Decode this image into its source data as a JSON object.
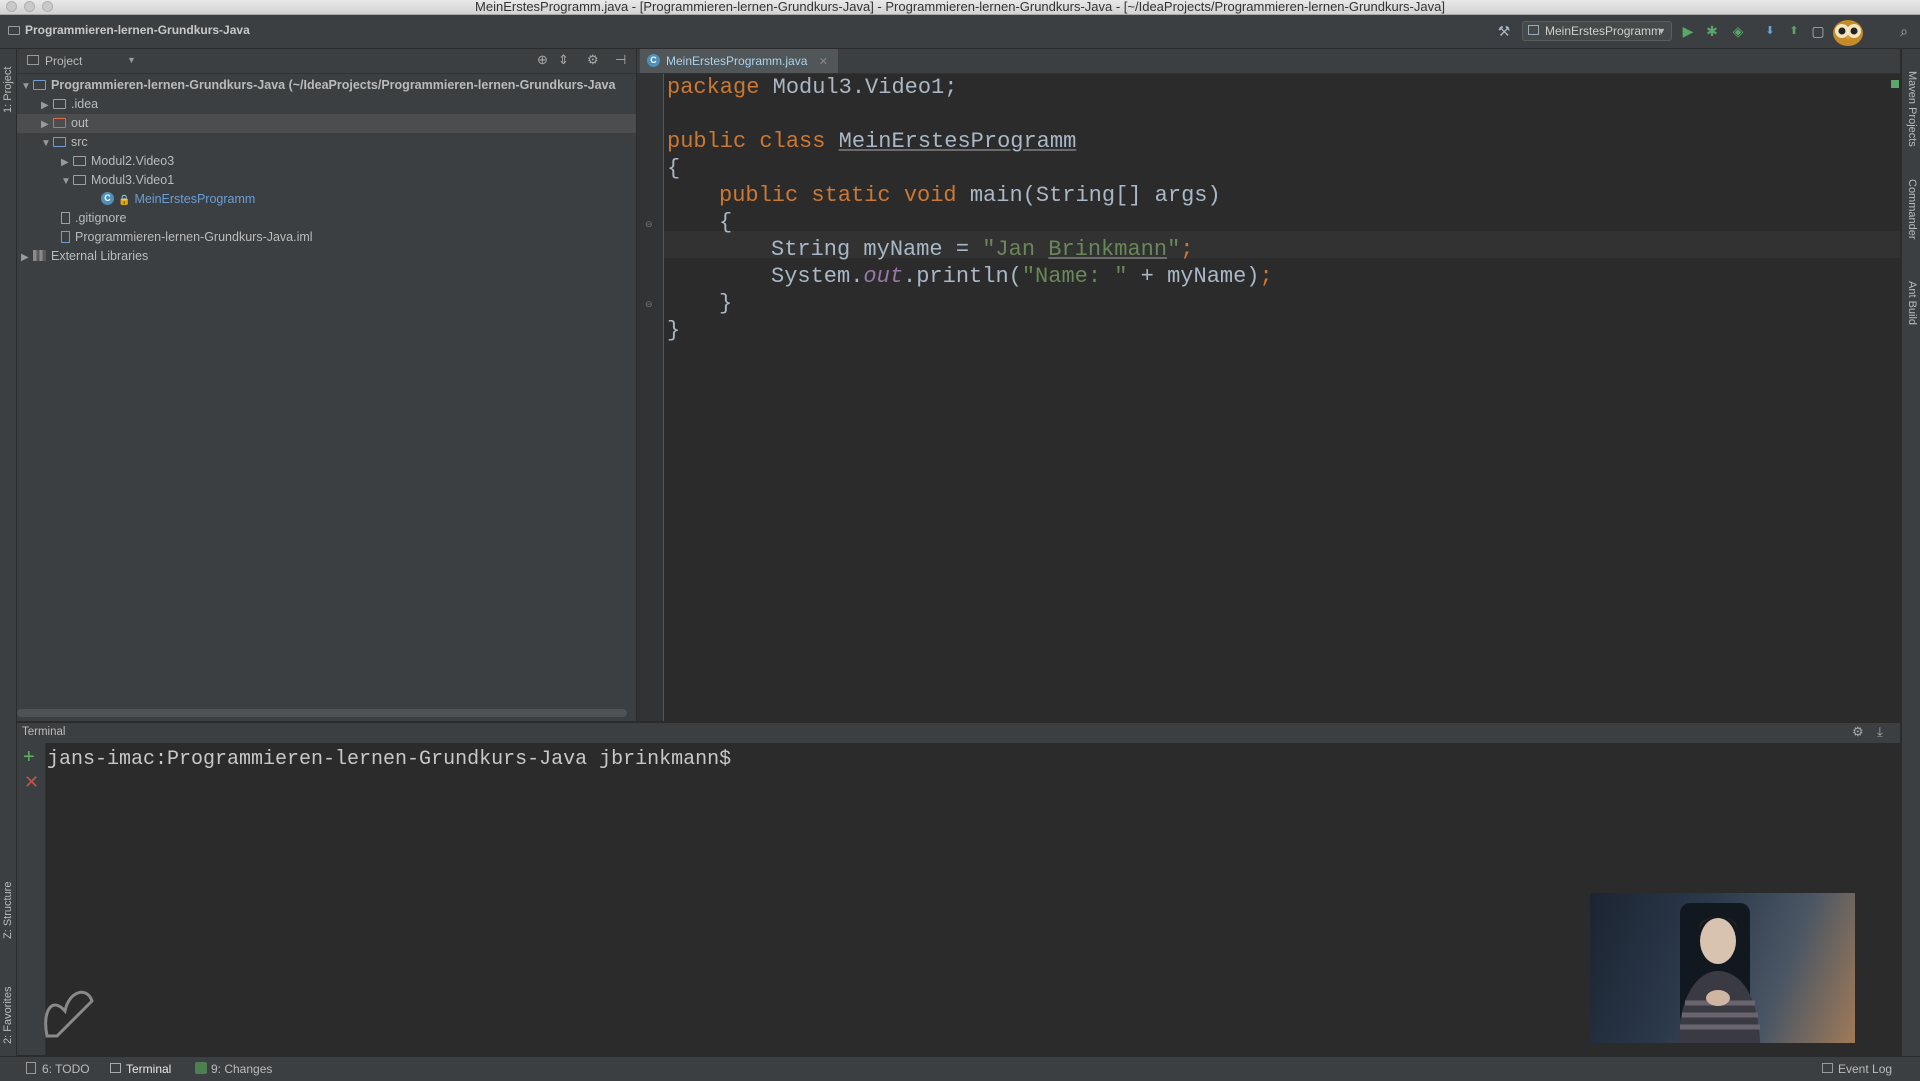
{
  "window": {
    "title": "MeinErstesProgramm.java - [Programmieren-lernen-Grundkurs-Java] - Programmieren-lernen-Grundkurs-Java - [~/IdeaProjects/Programmieren-lernen-Grundkurs-Java]"
  },
  "navbar": {
    "breadcrumb": "Programmieren-lernen-Grundkurs-Java",
    "run_config": "MeinErstesProgramm"
  },
  "left_strip": {
    "project_tab": "1: Project",
    "structure_tab": "Z: Structure",
    "favorites_tab": "2: Favorites"
  },
  "right_strip": {
    "maven_tab": "Maven Projects",
    "commander_tab": "Commander",
    "ant_tab": "Ant Build"
  },
  "project_panel": {
    "title": "Project",
    "tree": [
      {
        "label": "Programmieren-lernen-Grundkurs-Java",
        "suffix": "(~/IdeaProjects/Programmieren-lernen-Grundkurs-Java"
      },
      {
        "label": ".idea"
      },
      {
        "label": "out"
      },
      {
        "label": "src"
      },
      {
        "label": "Modul2.Video3"
      },
      {
        "label": "Modul3.Video1"
      },
      {
        "label": "MeinErstesProgramm"
      },
      {
        "label": ".gitignore"
      },
      {
        "label": "Programmieren-lernen-Grundkurs-Java.iml"
      },
      {
        "label": "External Libraries"
      }
    ]
  },
  "editor": {
    "tab_label": "MeinErstesProgramm.java",
    "code": {
      "l1_kw": "package",
      "l1_rest": " Modul3.Video1;",
      "l2_kw": "public class",
      "l2_name": "MeinErstesProgramm",
      "l3": "{",
      "l4_kw": "public static void",
      "l4_rest": " main(String[] args)",
      "l5": "{",
      "l6_a": "String myName = ",
      "l6_q": "\"Jan ",
      "l6_b": "Brinkmann",
      "l6_c": "\"",
      "l6_d": ";",
      "l7_a": "System.",
      "l7_out": "out",
      "l7_b": ".println(",
      "l7_str": "\"Name: \"",
      "l7_c": " + myName)",
      "l7_d": ";",
      "l8": "}",
      "l9": "}"
    }
  },
  "terminal": {
    "title": "Terminal",
    "prompt": "jans-imac:Programmieren-lernen-Grundkurs-Java jbrinkmann$"
  },
  "statusbar": {
    "todo": "6: TODO",
    "terminal": "Terminal",
    "changes": "9: Changes",
    "event_log": "Event Log"
  }
}
